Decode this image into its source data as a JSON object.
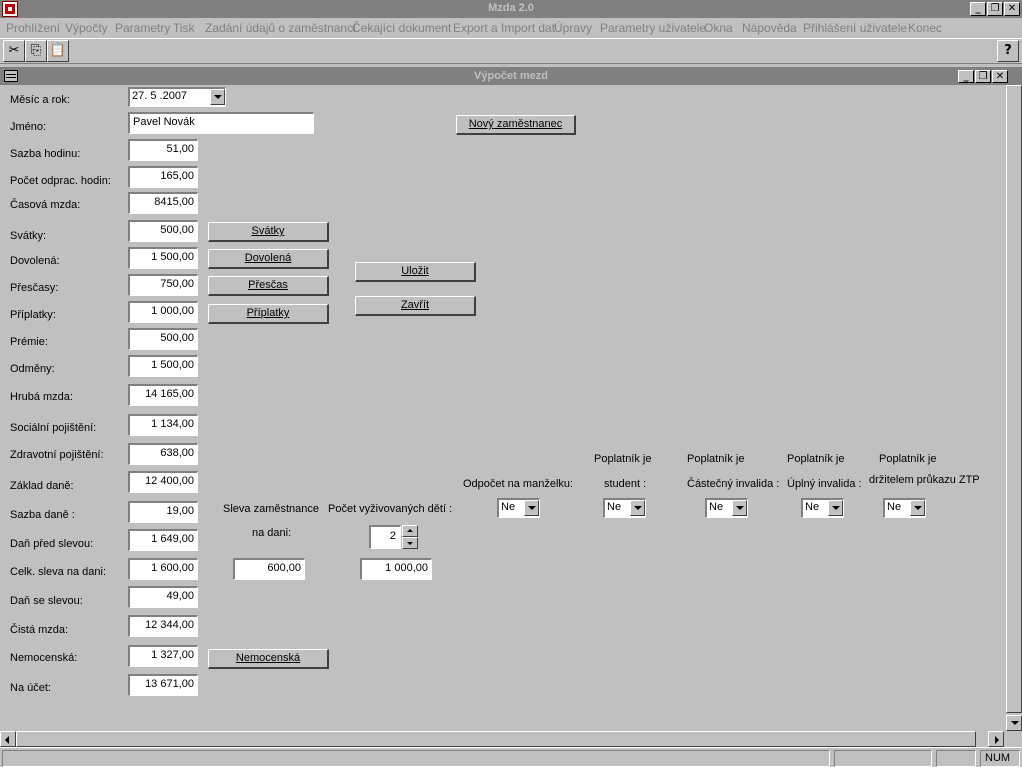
{
  "app": {
    "title": "Mzda 2.0"
  },
  "window": {
    "minimize": "_",
    "restore": "❐",
    "close": "✕"
  },
  "menu": [
    "Prohlížení",
    "Výpočty",
    "Parametry",
    "Tisk",
    "Zadání údajů o zaměstnanci",
    "Čekající dokument",
    "Export a Import dat",
    "Úpravy",
    "Parametry uživatele",
    "Okna",
    "Nápověda",
    "Přihlášení uživatele",
    "Konec"
  ],
  "toolbar": {
    "cut": "✂",
    "copy": "⎘",
    "paste": "📋",
    "help": "?"
  },
  "child": {
    "title": "Výpočet mezd"
  },
  "form": {
    "month_year": {
      "label": "Měsíc a rok:",
      "value": "27. 5 .2007"
    },
    "name": {
      "label": "Jméno:",
      "value": "Pavel Novák"
    },
    "fields": [
      {
        "label": "Sazba hodinu:",
        "value": "51,00"
      },
      {
        "label": "Počet odprac. hodin:",
        "value": "165,00"
      },
      {
        "label": "Časová mzda:",
        "value": "8415,00"
      },
      {
        "label": "Svátky:",
        "value": "500,00"
      },
      {
        "label": "Dovolená:",
        "value": "1 500,00"
      },
      {
        "label": "Přesčasy:",
        "value": "750,00"
      },
      {
        "label": "Příplatky:",
        "value": "1 000,00"
      },
      {
        "label": "Prémie:",
        "value": "500,00"
      },
      {
        "label": "Odměny:",
        "value": "1 500,00"
      },
      {
        "label": "Hrubá mzda:",
        "value": "14 165,00"
      },
      {
        "label": "Sociální pojištění:",
        "value": "1 134,00"
      },
      {
        "label": "Zdravotní pojištění:",
        "value": "638,00"
      },
      {
        "label": "Základ daně:",
        "value": "12 400,00"
      },
      {
        "label": "Sazba daně :",
        "value": "19,00"
      },
      {
        "label": "Daň před slevou:",
        "value": "1 649,00"
      },
      {
        "label": "Celk. sleva na dani:",
        "value": "1 600,00"
      },
      {
        "label": "Daň se slevou:",
        "value": "49,00"
      },
      {
        "label": "Čistá mzda:",
        "value": "12 344,00"
      },
      {
        "label": "Nemocenská:",
        "value": "1 327,00"
      },
      {
        "label": "Na účet:",
        "value": "13 671,00"
      }
    ],
    "buttons": {
      "new_employee": "Nový zaměstnanec",
      "holidays": "Svátky",
      "vacation": "Dovolená",
      "overtime": "Přesčas",
      "surcharges": "Příplatky",
      "save": "Uložit",
      "close": "Zavřít",
      "sick_pay": "Nemocenská"
    },
    "employee_discount": {
      "label_line1": "Sleva zaměstnance",
      "label_line2": "na dani:",
      "value": "600,00"
    },
    "children": {
      "label": "Počet vyživovaných dětí :",
      "count": "2",
      "amount": "1 000,00"
    },
    "options": [
      {
        "line1": "",
        "line2": "Odpočet na manželku:",
        "value": "Ne"
      },
      {
        "line1": "Poplatník je",
        "line2": "student :",
        "value": "Ne"
      },
      {
        "line1": "Poplatník je",
        "line2": "Částečný invalida :",
        "value": "Ne"
      },
      {
        "line1": "Poplatník je",
        "line2": "Úplný invalida :",
        "value": "Ne"
      },
      {
        "line1": "Poplatník je",
        "line2": "držitelem průkazu ZTP",
        "value": "Ne"
      }
    ]
  },
  "status": {
    "num": "NUM"
  }
}
